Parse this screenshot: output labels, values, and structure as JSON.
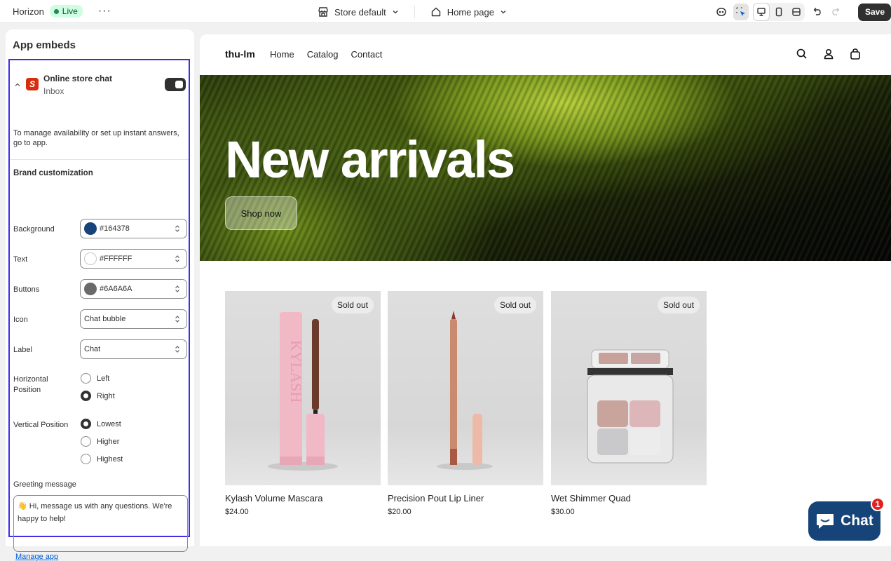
{
  "topbar": {
    "store": "Horizon",
    "status": "Live",
    "more_icon": "more-horizontal-icon",
    "theme_selector": "Store default",
    "page_selector": "Home page",
    "save_label": "Save"
  },
  "sidebar": {
    "title": "App embeds",
    "app": {
      "name": "Online store chat",
      "subtitle": "Inbox",
      "logo_letter": "S",
      "enabled": true
    },
    "manage_text": "To manage availability or set up instant answers, go to app.",
    "brand_title": "Brand customization",
    "fields": {
      "background": {
        "label": "Background",
        "value": "#164378",
        "color": "#164378"
      },
      "text": {
        "label": "Text",
        "value": "#FFFFFF",
        "color": "#FFFFFF"
      },
      "buttons": {
        "label": "Buttons",
        "value": "#6A6A6A",
        "color": "#6A6A6A"
      },
      "icon": {
        "label": "Icon",
        "value": "Chat bubble"
      },
      "label": {
        "label": "Label",
        "value": "Chat"
      }
    },
    "horizontal": {
      "label": "Horizontal Position",
      "options": [
        "Left",
        "Right"
      ],
      "selected": "Right"
    },
    "vertical": {
      "label": "Vertical Position",
      "options": [
        "Lowest",
        "Higher",
        "Highest"
      ],
      "selected": "Lowest"
    },
    "greeting": {
      "label": "Greeting message",
      "value": "👋 Hi, message us with any questions. We're happy to help!"
    },
    "manage_link": "Manage app"
  },
  "preview": {
    "store_name": "thu-lm",
    "nav": [
      "Home",
      "Catalog",
      "Contact"
    ],
    "hero_title": "New arrivals",
    "hero_button": "Shop now",
    "products": [
      {
        "title": "Kylash Volume Mascara",
        "price": "$24.00",
        "badge": "Sold out"
      },
      {
        "title": "Precision Pout Lip Liner",
        "price": "$20.00",
        "badge": "Sold out"
      },
      {
        "title": "Wet Shimmer Quad",
        "price": "$30.00",
        "badge": "Sold out"
      }
    ],
    "chat_label": "Chat",
    "chat_badge": "1",
    "chat_color": "#164378"
  }
}
